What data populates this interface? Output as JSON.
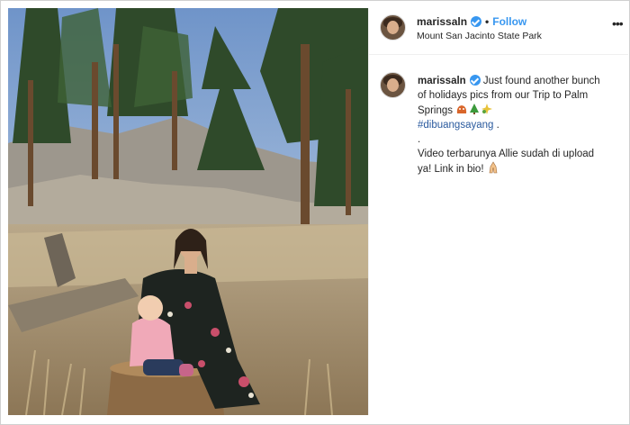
{
  "post": {
    "username": "marissaln",
    "follow_label": "Follow",
    "separator": "•",
    "location": "Mount San Jacinto State Park",
    "more_label": "•••",
    "caption": {
      "username": "marissaln",
      "line1": "Just found another bunch of holidays pics from our Trip to Palm Springs",
      "emojis": [
        "gingerbread-emoji",
        "tree-emoji",
        "sparkle-emoji"
      ],
      "hashtag": "#dibuangsayang",
      "hashtag_suffix": " .",
      "dot_line": ".",
      "line2": "Video terbarunya Allie sudah di upload ya! Link in bio!",
      "end_emoji": "pray-emoji"
    },
    "photo_alt": "Woman and toddler sitting on a tree stump in a pine forest"
  },
  "colors": {
    "link_blue": "#3897f0",
    "hashtag": "#2a5a9e",
    "text": "#262626",
    "border": "#efefef"
  }
}
